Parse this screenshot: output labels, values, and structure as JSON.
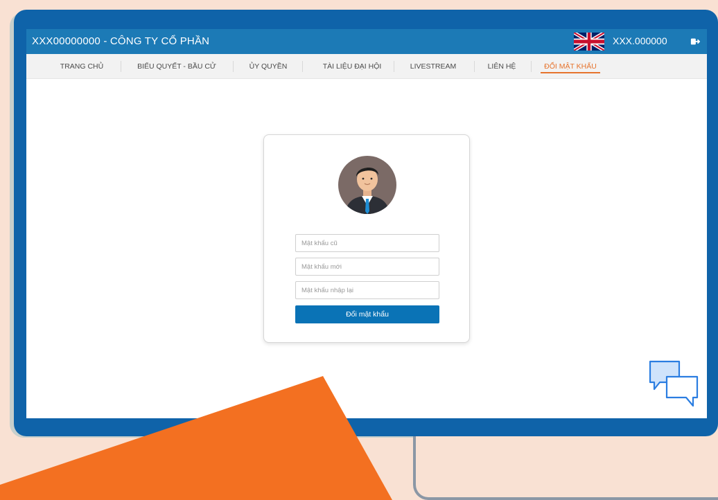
{
  "header": {
    "company": "XXX00000000 - CÔNG TY CỔ PHẦN",
    "account": "XXX.000000",
    "language_flag": "uk-flag-icon",
    "logout_icon": "logout-icon"
  },
  "nav": {
    "items": [
      {
        "label": "TRANG CHỦ"
      },
      {
        "label": "BIỂU QUYẾT - BẦU CỬ"
      },
      {
        "label": "ỦY QUYỀN"
      },
      {
        "label": "TÀI LIỆU ĐẠI HỘI"
      },
      {
        "label": "LIVESTREAM"
      },
      {
        "label": "LIÊN HỆ"
      },
      {
        "label": "ĐỔI MẬT KHẨU"
      }
    ],
    "active_index": 6
  },
  "form": {
    "avatar_icon": "user-avatar-icon",
    "old_password_placeholder": "Mật khẩu cũ",
    "new_password_placeholder": "Mật khẩu mới",
    "confirm_password_placeholder": "Mật khẩu nhập lại",
    "submit_label": "Đổi mật khẩu"
  },
  "chat_icon": "chat-bubbles-icon",
  "colors": {
    "header_blue": "#1c7ab6",
    "monitor_blue": "#0f63a9",
    "active_orange": "#e6732c",
    "button_blue": "#0a73b6",
    "background": "#f9e1d3",
    "decor_orange": "#f37021"
  }
}
